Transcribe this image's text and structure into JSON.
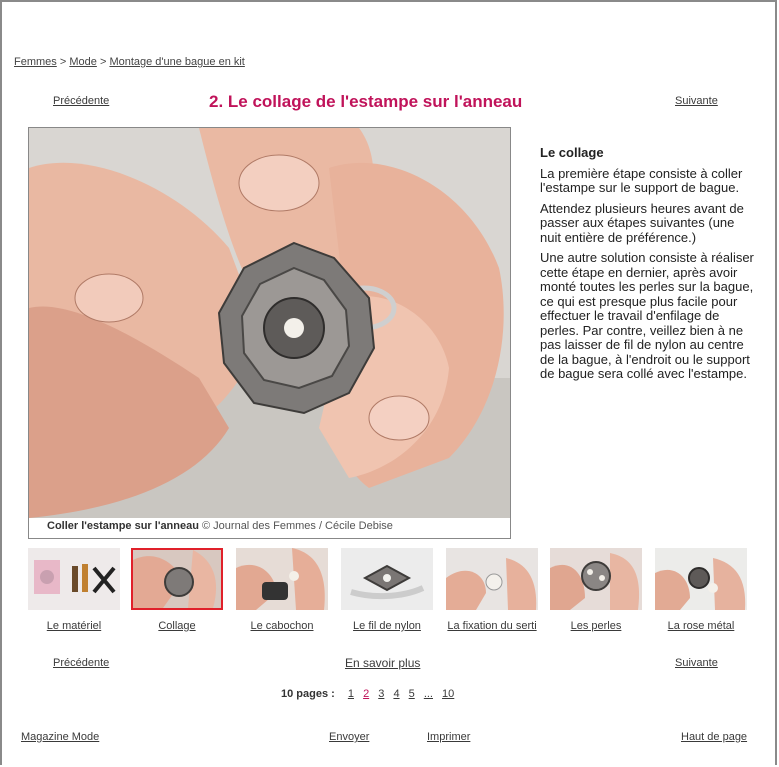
{
  "breadcrumb": {
    "items": [
      "Femmes",
      "Mode",
      "Montage d'une bague en kit"
    ],
    "separator": ">"
  },
  "nav": {
    "previous": "Précédente",
    "next": "Suivante",
    "more": "En savoir plus"
  },
  "title": "2. Le collage de l'estampe sur l'anneau",
  "photo": {
    "caption_bold": "Coller l'estampe sur l'anneau",
    "caption_credit": "© Journal des Femmes / Cécile Debise"
  },
  "side": {
    "heading": "Le collage",
    "paragraphs": [
      "La première étape consiste à coller l'estampe sur le support de bague.",
      "Attendez plusieurs heures avant de passer aux étapes suivantes (une nuit entière de préférence.)",
      "Une autre solution consiste à réaliser cette étape en dernier, après avoir monté toutes les perles sur la bague, ce qui est presque plus facile pour effectuer le travail d'enfilage de perles. Par contre, veillez bien à ne pas laisser de fil de nylon au centre de la bague, à l'endroit ou le support de bague sera collé avec l'estampe."
    ]
  },
  "thumbnails": [
    {
      "label": "Le matériel",
      "selected": false
    },
    {
      "label": "Collage",
      "selected": true
    },
    {
      "label": "Le cabochon",
      "selected": false
    },
    {
      "label": "Le fil de nylon",
      "selected": false
    },
    {
      "label": "La fixation du serti",
      "selected": false
    },
    {
      "label": "Les perles",
      "selected": false
    },
    {
      "label": "La rose métal",
      "selected": false
    }
  ],
  "pagination": {
    "label": "10 pages :",
    "pages": [
      "1",
      "2",
      "3",
      "4",
      "5",
      "...",
      "10"
    ],
    "current": "2"
  },
  "footer": {
    "magazine": "Magazine Mode",
    "send": "Envoyer",
    "print": "Imprimer",
    "top": "Haut de page"
  },
  "colors": {
    "title": "#c0135a",
    "selected_border": "#e0202a",
    "frame": "#8a8a8a"
  }
}
